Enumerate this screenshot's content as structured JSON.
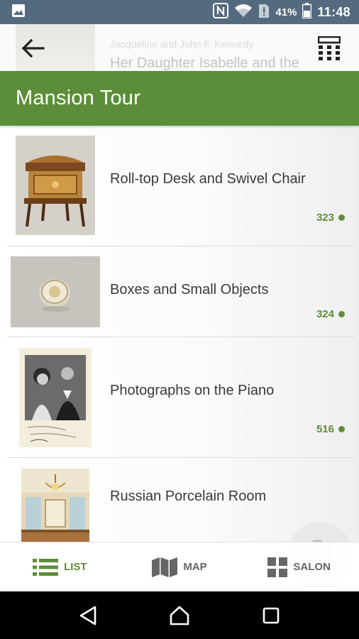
{
  "status_bar": {
    "battery_percent": "41%",
    "time": "11:48",
    "icons": [
      "gallery-icon",
      "nfc-icon",
      "wifi-icon",
      "no-sim-icon",
      "battery-icon"
    ]
  },
  "header": {
    "behind_title_top": "Jacqueline and John F. Kennedy",
    "behind_title": "Her Daughter Isabelle and the",
    "back_icon": "arrow-left-icon",
    "keypad_icon": "keypad-icon"
  },
  "title_bar": {
    "title": "Mansion Tour",
    "color": "#5c8e39"
  },
  "items": [
    {
      "title": "Roll-top Desk and Swivel Chair",
      "stop": "323"
    },
    {
      "title": "Boxes and Small Objects",
      "stop": "324"
    },
    {
      "title": "Photographs on the Piano",
      "stop": "516"
    },
    {
      "title": "Russian Porcelain Room",
      "stop": ""
    }
  ],
  "bottom_nav": {
    "tabs": [
      {
        "label": "LIST",
        "icon": "list-icon",
        "active": true
      },
      {
        "label": "MAP",
        "icon": "map-icon",
        "active": false
      },
      {
        "label": "SALON",
        "icon": "salon-grid-icon",
        "active": false
      }
    ]
  },
  "floating": {
    "icon": "camera-icon"
  },
  "android_nav": {
    "icons": [
      "back-triangle-icon",
      "home-icon",
      "recents-icon"
    ]
  }
}
